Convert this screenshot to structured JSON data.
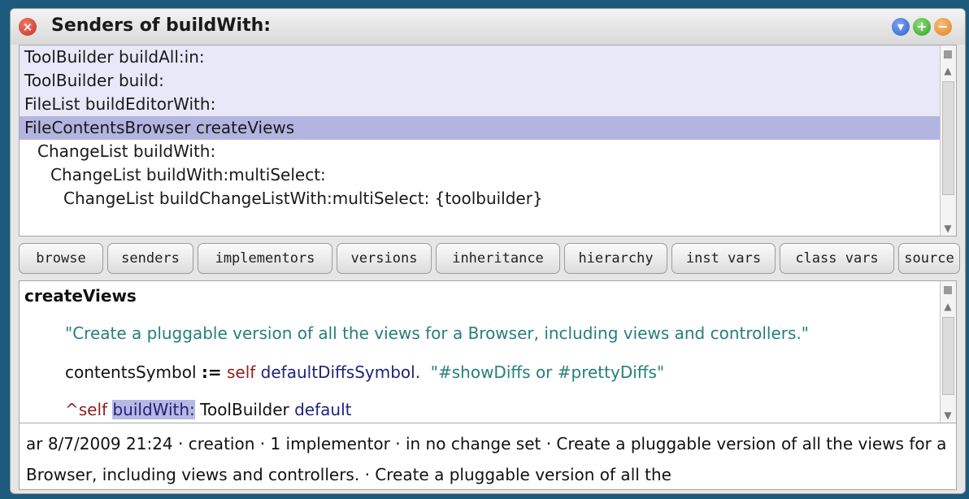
{
  "window": {
    "title": "Senders of buildWith:",
    "close_icon": "×",
    "menu_icon": "▾",
    "expand_icon": "+",
    "collapse_icon": "−"
  },
  "list": {
    "items": [
      {
        "label": "ToolBuilder buildAll:in:",
        "indent": 0,
        "state": "shaded"
      },
      {
        "label": "ToolBuilder build:",
        "indent": 0,
        "state": "shaded"
      },
      {
        "label": "FileList buildEditorWith:",
        "indent": 0,
        "state": "shaded"
      },
      {
        "label": "FileContentsBrowser createViews",
        "indent": 0,
        "state": "selected"
      },
      {
        "label": "ChangeList buildWith:",
        "indent": 1,
        "state": "plain"
      },
      {
        "label": "ChangeList buildWith:multiSelect:",
        "indent": 2,
        "state": "plain"
      },
      {
        "label": "ChangeList buildChangeListWith:multiSelect: {toolbuilder}",
        "indent": 3,
        "state": "plain"
      }
    ]
  },
  "toolbar": {
    "browse": "browse",
    "senders": "senders",
    "implementors": "implementors",
    "versions": "versions",
    "inheritance": "inheritance",
    "hierarchy": "hierarchy",
    "inst_vars": "inst vars",
    "class_vars": "class vars",
    "source": "source"
  },
  "code": {
    "selector": "createViews",
    "comment": "\"Create a pluggable version of all the views for a Browser, including views and controllers.\"",
    "line1_var": "contentsSymbol",
    "line1_assign": ":=",
    "line1_self": "self",
    "line1_msg": "defaultDiffsSymbol.",
    "line1_comment": "\"#showDiffs or #prettyDiffs\"",
    "line2_ret": "^self",
    "line2_msg": "buildWith:",
    "line2_class": "ToolBuilder",
    "line2_arg": "default"
  },
  "info": {
    "text": "ar 8/7/2009 21:24 · creation · 1 implementor · in no change set · Create a pluggable version of all the views for a Browser, including views and controllers. · Create a pluggable version of all the"
  },
  "scrollbar": {
    "up_icon": "▲",
    "down_icon": "▼"
  }
}
